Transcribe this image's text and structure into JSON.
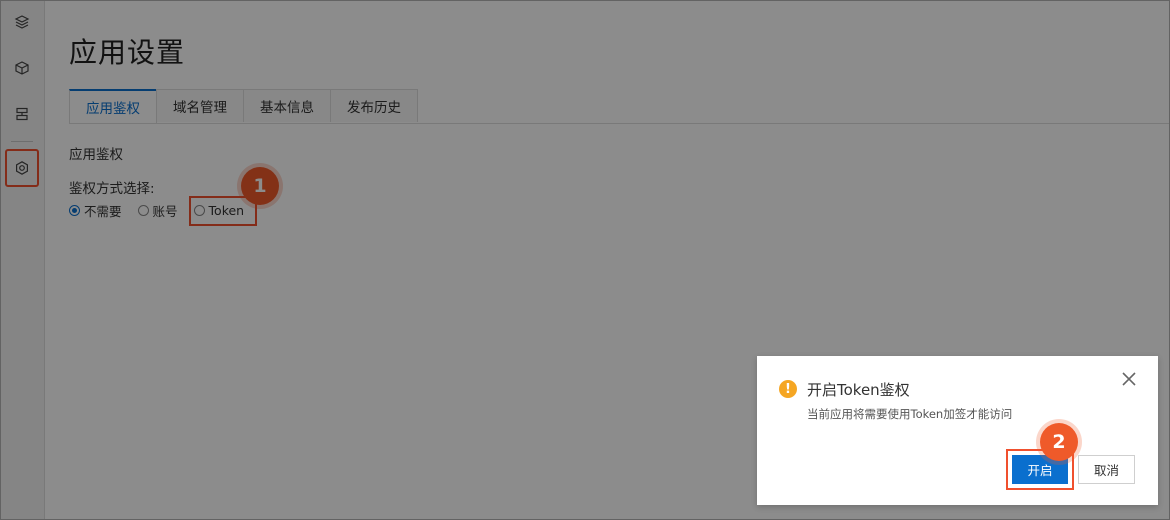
{
  "page": {
    "title": "应用设置"
  },
  "sidebar": {
    "icons": [
      "layers-icon",
      "cube-icon",
      "server-icon",
      "settings-icon"
    ]
  },
  "tabs": [
    {
      "label": "应用鉴权",
      "active": true
    },
    {
      "label": "域名管理",
      "active": false
    },
    {
      "label": "基本信息",
      "active": false
    },
    {
      "label": "发布历史",
      "active": false
    }
  ],
  "auth": {
    "section_title": "应用鉴权",
    "method_label": "鉴权方式选择:",
    "options": [
      {
        "label": "不需要",
        "selected": true
      },
      {
        "label": "账号",
        "selected": false
      },
      {
        "label": "Token",
        "selected": false
      }
    ]
  },
  "steps": {
    "one": "1",
    "two": "2"
  },
  "dialog": {
    "title": "开启Token鉴权",
    "description": "当前应用将需要使用Token加签才能访问",
    "confirm_label": "开启",
    "cancel_label": "取消"
  },
  "colors": {
    "accent": "#0a6fce",
    "highlight": "#f0502e",
    "warning": "#f5a623"
  }
}
